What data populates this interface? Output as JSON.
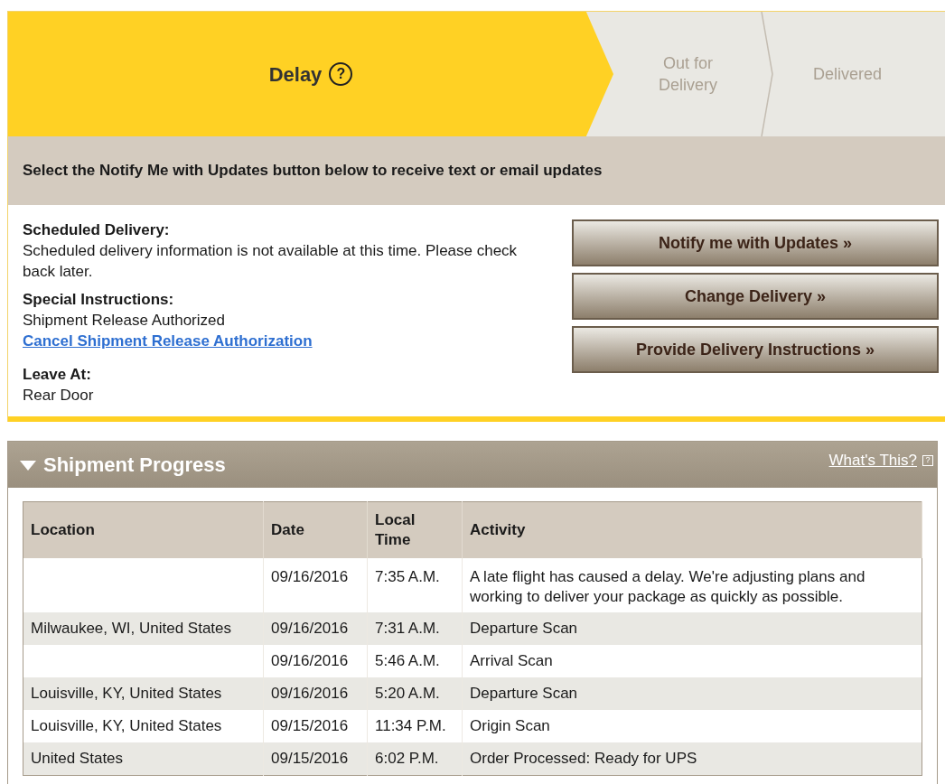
{
  "progress_steps": [
    {
      "label": "Delay",
      "selected": true,
      "help_icon": "?"
    },
    {
      "label": "Out for Delivery",
      "selected": false
    },
    {
      "label": "Delivered",
      "selected": false
    }
  ],
  "notice": "Select the Notify Me with Updates button below to receive text or email updates",
  "details": [
    {
      "heading": "Scheduled Delivery:",
      "text": "Scheduled delivery information is not available at this time. Please check back later."
    },
    {
      "heading": "Special Instructions:",
      "text": "Shipment Release Authorized",
      "link": "Cancel Shipment Release Authorization"
    },
    {
      "heading": "Leave At:",
      "text": "Rear Door"
    }
  ],
  "buttons": [
    "Notify me with Updates »",
    "Change Delivery »",
    "Provide Delivery Instructions »"
  ],
  "shipment_progress": {
    "title": "Shipment Progress",
    "expanded": true,
    "help_link": "What's This?",
    "help_icon": "?",
    "columns": [
      "Location",
      "Date",
      "Local Time",
      "Activity"
    ],
    "rows": [
      [
        "",
        "09/16/2016",
        "7:35 A.M.",
        "A late flight has caused a delay. We're adjusting plans and working to deliver your package as quickly as possible."
      ],
      [
        "Milwaukee, WI, United States",
        "09/16/2016",
        "7:31 A.M.",
        "Departure Scan"
      ],
      [
        "",
        "09/16/2016",
        "5:46 A.M.",
        "Arrival Scan"
      ],
      [
        "Louisville, KY, United States",
        "09/16/2016",
        "5:20 A.M.",
        "Departure Scan"
      ],
      [
        "Louisville, KY, United States",
        "09/15/2016",
        "11:34 P.M.",
        "Origin Scan"
      ],
      [
        "United States",
        "09/15/2016",
        "6:02 P.M.",
        "Order Processed: Ready for UPS"
      ]
    ]
  }
}
